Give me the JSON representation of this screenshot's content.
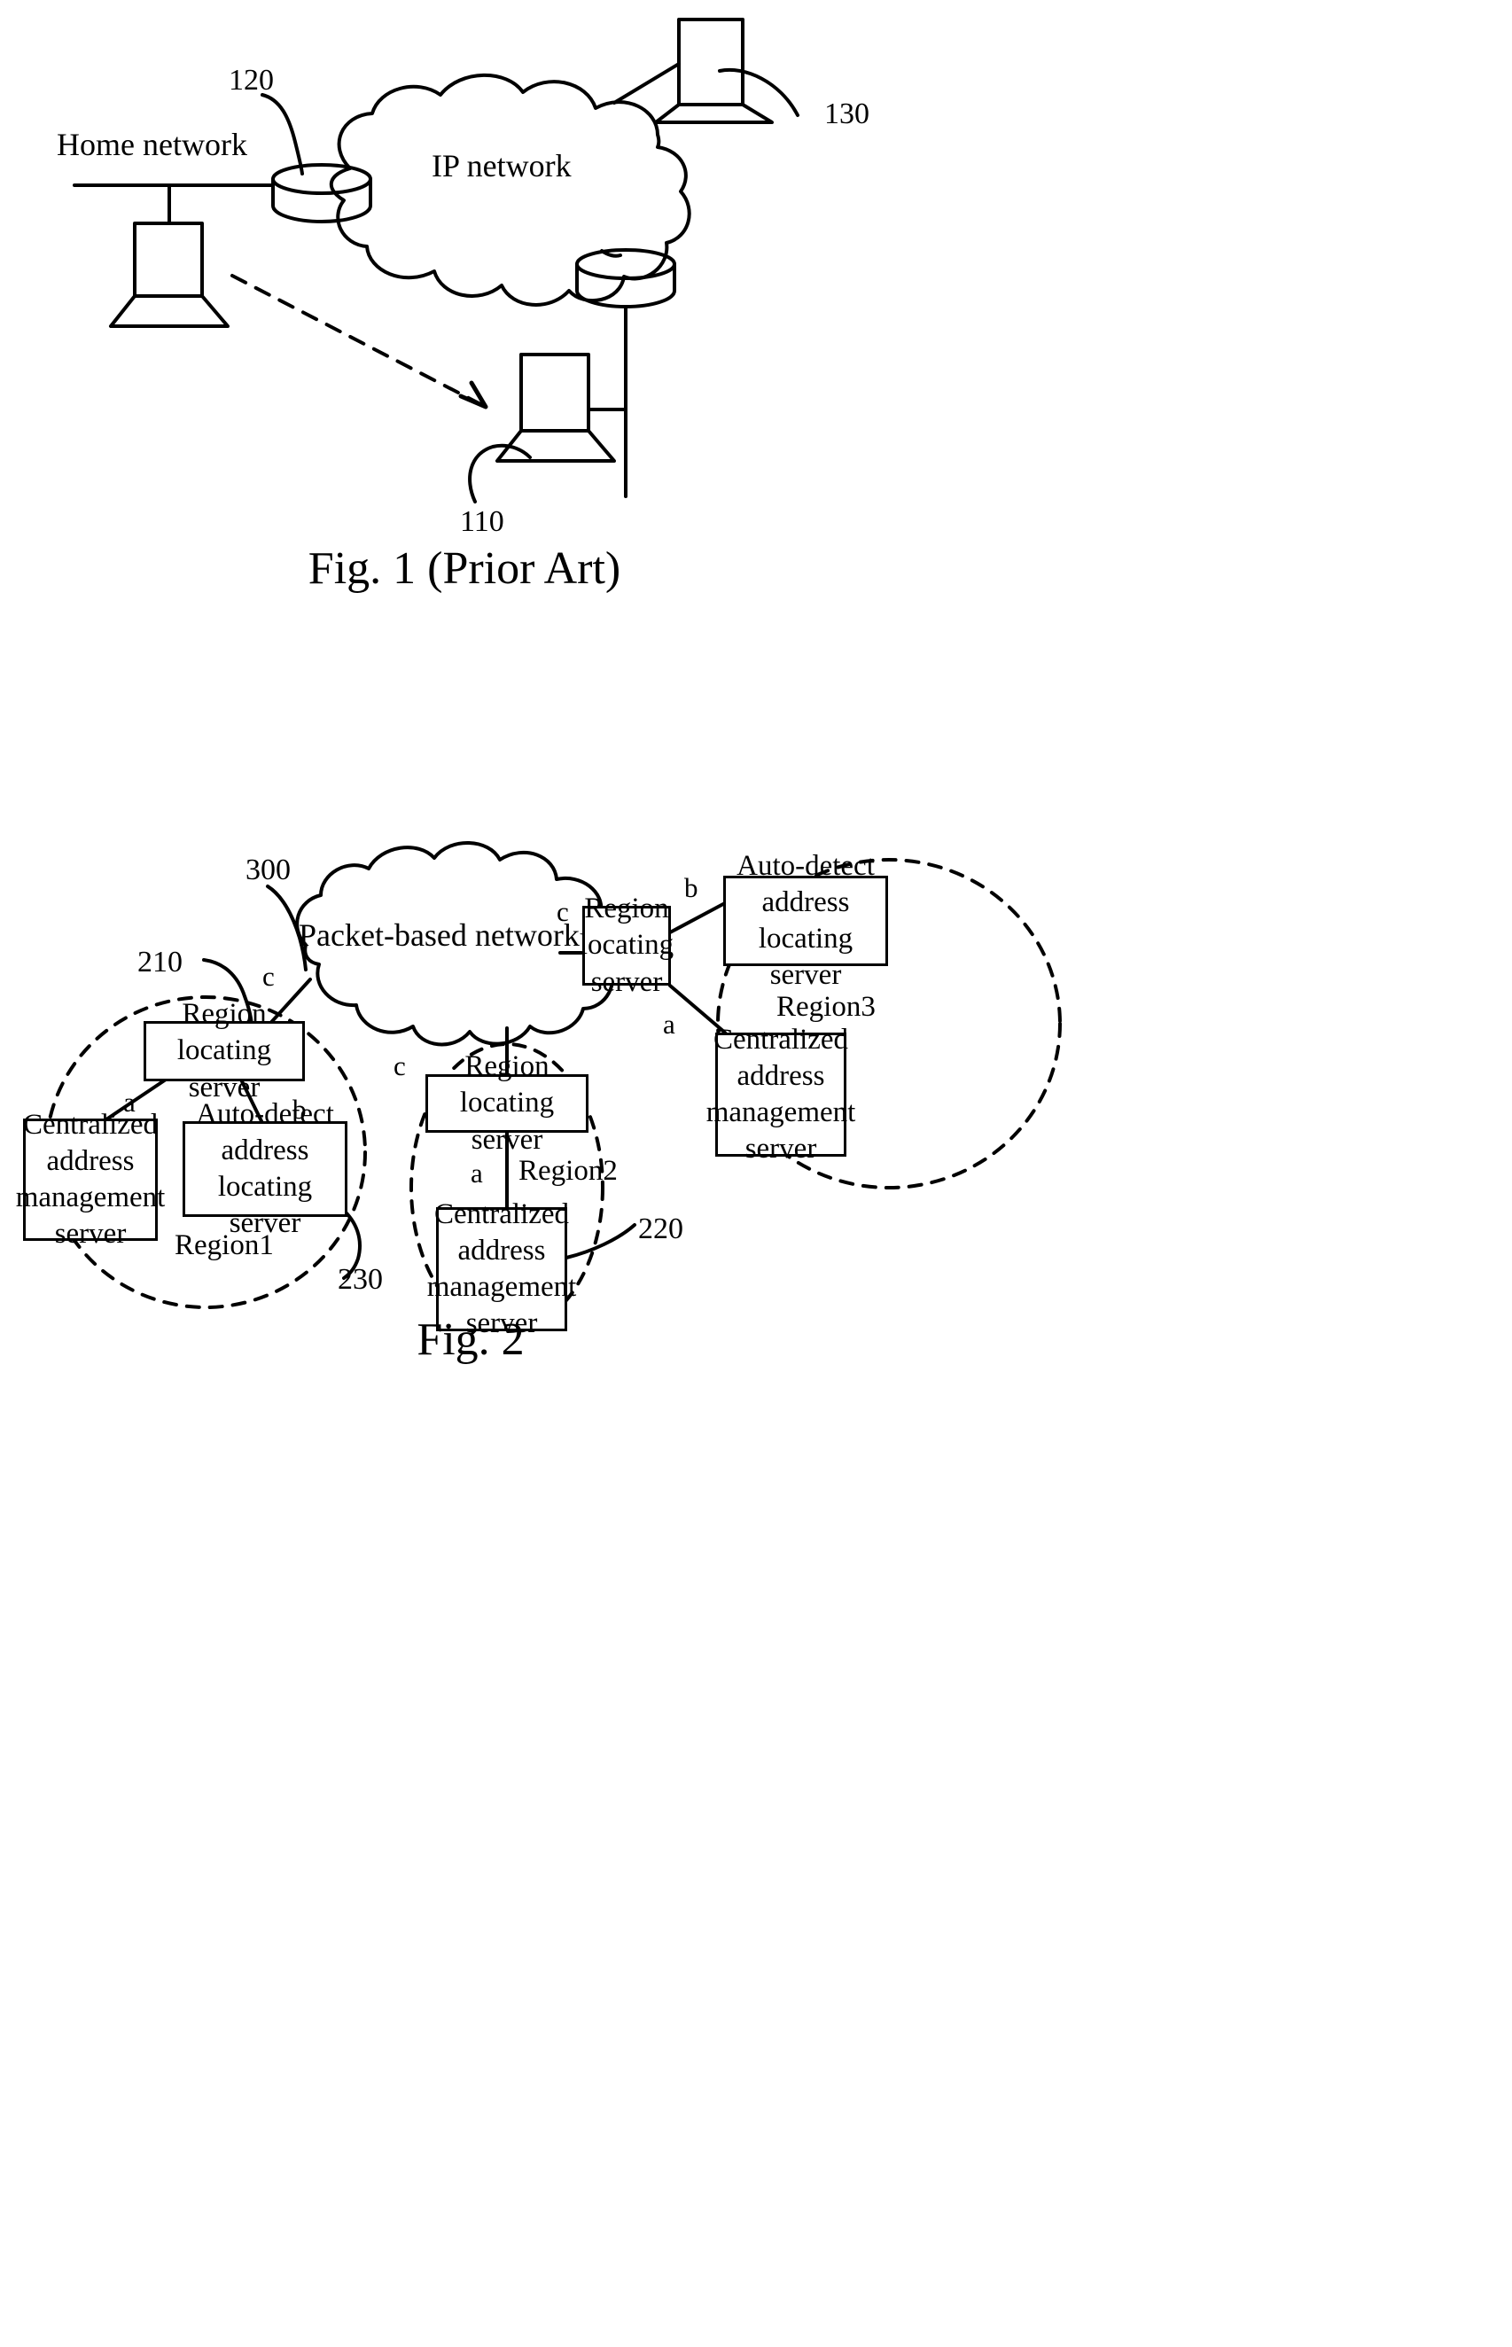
{
  "figure1": {
    "caption": "Fig. 1 (Prior Art)",
    "labels": {
      "home_network": "Home network",
      "ip_network": "IP network",
      "ref_120": "120",
      "ref_130": "130",
      "ref_110": "110"
    },
    "icons": {
      "router_left": "router-cylinder-icon",
      "router_right": "router-cylinder-icon",
      "terminal_home": "computer-terminal-icon",
      "terminal_remote": "computer-terminal-icon",
      "terminal_bottom": "computer-terminal-icon",
      "cloud": "network-cloud-icon",
      "arrow": "dashed-arrow-icon"
    }
  },
  "figure2": {
    "caption": "Fig. 2",
    "labels": {
      "packet_network": "Packet-based network",
      "ref_300": "300",
      "ref_210": "210",
      "ref_220": "220",
      "ref_230": "230"
    },
    "regions": [
      {
        "name": "Region1",
        "nodes": [
          {
            "id": "r1-region-locating-server",
            "text": "Region locating server"
          },
          {
            "id": "r1-centralized-address-management-server",
            "text": "Centralized address management server"
          },
          {
            "id": "r1-auto-detect-address-locating-server",
            "text": "Auto-detect address locating server"
          }
        ],
        "connectors": [
          {
            "id": "r1-conn-a",
            "label": "a"
          },
          {
            "id": "r1-conn-b",
            "label": "b"
          },
          {
            "id": "r1-conn-c",
            "label": "c"
          }
        ]
      },
      {
        "name": "Region2",
        "nodes": [
          {
            "id": "r2-region-locating-server",
            "text": "Region locating server"
          },
          {
            "id": "r2-centralized-address-management-server",
            "text": "Centralized address management server"
          }
        ],
        "connectors": [
          {
            "id": "r2-conn-a",
            "label": "a"
          },
          {
            "id": "r2-conn-c",
            "label": "c"
          }
        ]
      },
      {
        "name": "Region3",
        "nodes": [
          {
            "id": "r3-region-locating-server",
            "text": "Region locating server"
          },
          {
            "id": "r3-auto-detect-address-locating-server",
            "text": "Auto-detect address locating server"
          },
          {
            "id": "r3-centralized-address-management-server",
            "text": "Centralized address management server"
          }
        ],
        "connectors": [
          {
            "id": "r3-conn-a",
            "label": "a"
          },
          {
            "id": "r3-conn-b",
            "label": "b"
          },
          {
            "id": "r3-conn-c",
            "label": "c"
          }
        ]
      }
    ],
    "icons": {
      "cloud": "network-cloud-icon",
      "region_boundary": "dashed-circle-icon"
    }
  }
}
